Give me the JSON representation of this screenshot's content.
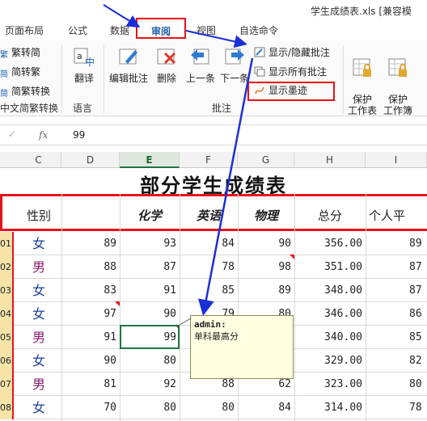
{
  "window": {
    "title": "学生成绩表.xls [兼容模"
  },
  "tabs": [
    {
      "label": "页面布局"
    },
    {
      "label": "公式"
    },
    {
      "label": "数据"
    },
    {
      "label": "审阅",
      "active": true
    },
    {
      "label": "视图"
    },
    {
      "label": "自选命令"
    }
  ],
  "ribbon": {
    "chinese_conversion": {
      "items": [
        "繁转简",
        "简转繁",
        "简繁转换"
      ],
      "group_label": "中文简繁转换"
    },
    "language": {
      "translate_label": "翻译",
      "group_label": "语言"
    },
    "comments": {
      "edit_label": "编辑批注",
      "delete_label": "删除",
      "prev_label": "上一条",
      "next_label": "下一条",
      "show_hide_label": "显示/隐藏批注",
      "show_all_label": "显示所有批注",
      "show_ink_label": "显示墨迹",
      "group_label": "批注"
    },
    "protect": {
      "protect_sheet_label": "保护\n工作表",
      "protect_workbook_label": "保护\n工作簿"
    }
  },
  "formula_bar": {
    "fx": "fx",
    "value": "99"
  },
  "columns": [
    "C",
    "D",
    "E",
    "F",
    "G",
    "H",
    "I"
  ],
  "selected_column": "E",
  "sheet": {
    "title": "部分学生成绩表",
    "headers": [
      "性别",
      "",
      "化学",
      "英语",
      "物理",
      "总分",
      "个人平"
    ],
    "rows": [
      {
        "no": "01",
        "gender": "女",
        "d": "89",
        "e": "93",
        "f": "84",
        "g": "90",
        "h": "356.00",
        "i": "89"
      },
      {
        "no": "02",
        "gender": "男",
        "d": "88",
        "e": "87",
        "f": "78",
        "g": "98",
        "h": "351.00",
        "i": "87"
      },
      {
        "no": "03",
        "gender": "女",
        "d": "83",
        "e": "91",
        "f": "85",
        "g": "89",
        "h": "348.00",
        "i": "87"
      },
      {
        "no": "04",
        "gender": "女",
        "d": "97",
        "e": "90",
        "f": "79",
        "g": "80",
        "h": "346.00",
        "i": "86"
      },
      {
        "no": "05",
        "gender": "男",
        "d": "91",
        "e": "99",
        "f": "",
        "g": "",
        "h": "340.00",
        "i": "85"
      },
      {
        "no": "06",
        "gender": "女",
        "d": "90",
        "e": "80",
        "f": "",
        "g": "",
        "h": "329.00",
        "i": "82"
      },
      {
        "no": "07",
        "gender": "男",
        "d": "81",
        "e": "92",
        "f": "88",
        "g": "62",
        "h": "323.00",
        "i": "80"
      },
      {
        "no": "08",
        "gender": "女",
        "d": "70",
        "e": "80",
        "f": "80",
        "g": "84",
        "h": "314.00",
        "i": "78"
      }
    ]
  },
  "comment": {
    "author": "admin:",
    "text": "单科最高分"
  }
}
